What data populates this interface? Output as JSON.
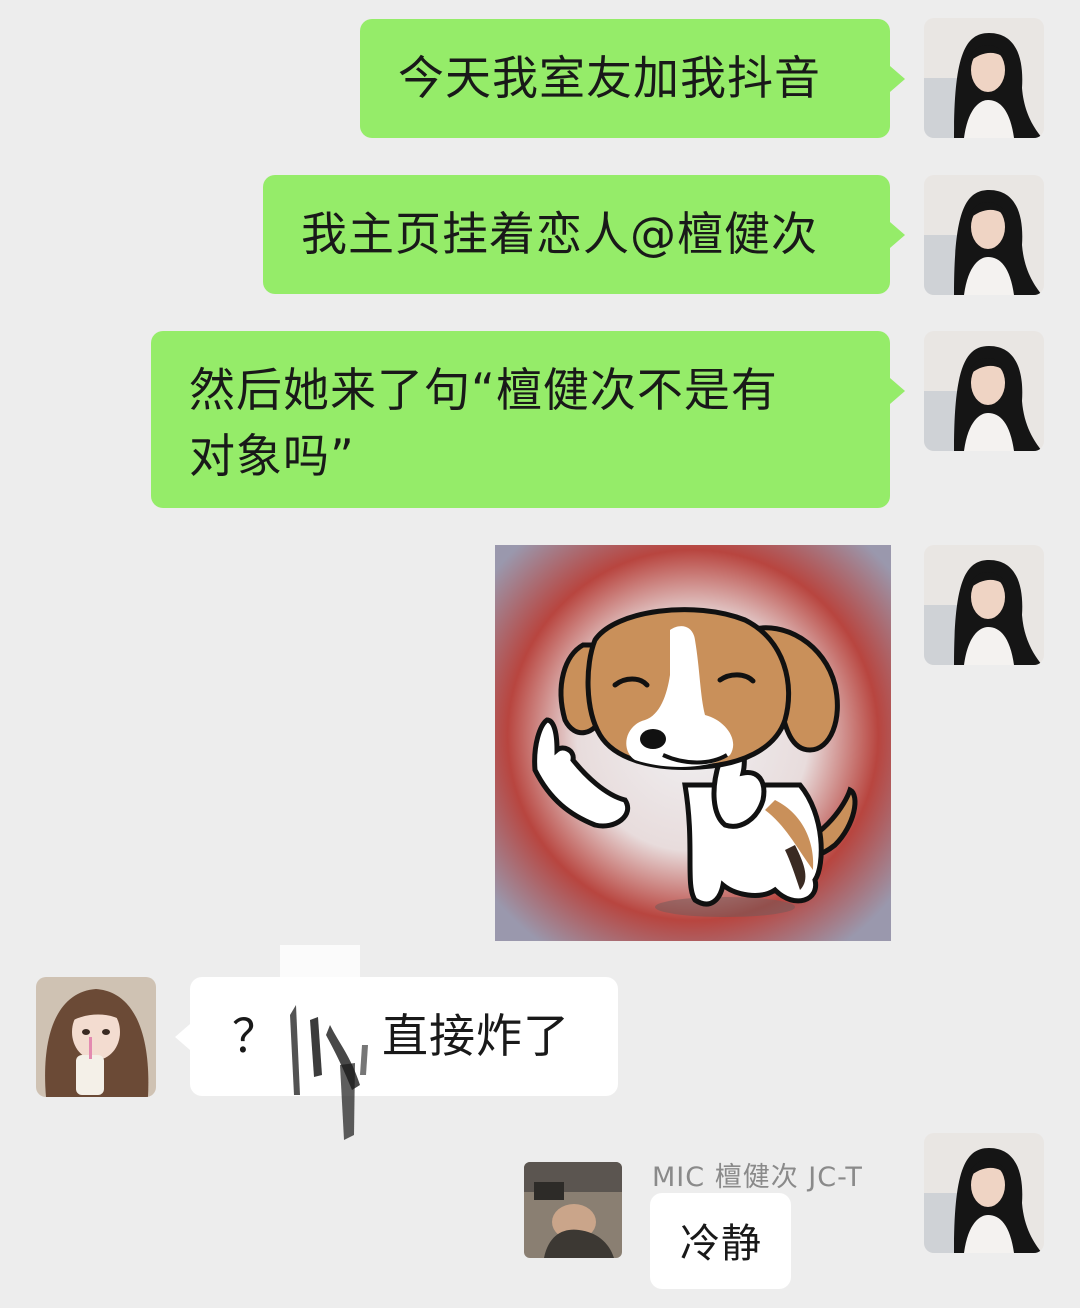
{
  "messages": [
    {
      "sender": "me",
      "type": "text",
      "text": "今天我室友加我抖音"
    },
    {
      "sender": "me",
      "type": "text",
      "text": "我主页挂着恋人@檀健次"
    },
    {
      "sender": "me",
      "type": "text",
      "lines": [
        "然后她来了句“檀健次不是有",
        "对象吗”"
      ]
    },
    {
      "sender": "me",
      "type": "sticker",
      "icon": "beagle-middle-finger-sticker"
    },
    {
      "sender": "friend",
      "type": "text",
      "prefix": "？",
      "suffix": "直接炸了",
      "redacted": true
    },
    {
      "sender": "me",
      "type": "quote",
      "name": "MIC 檀健次 JC-T",
      "text": "冷静"
    }
  ],
  "colors": {
    "background": "#ededed",
    "my_bubble": "#95ec69",
    "their_bubble": "#ffffff",
    "text": "#191919",
    "secondary_text": "#8a8a8a"
  }
}
